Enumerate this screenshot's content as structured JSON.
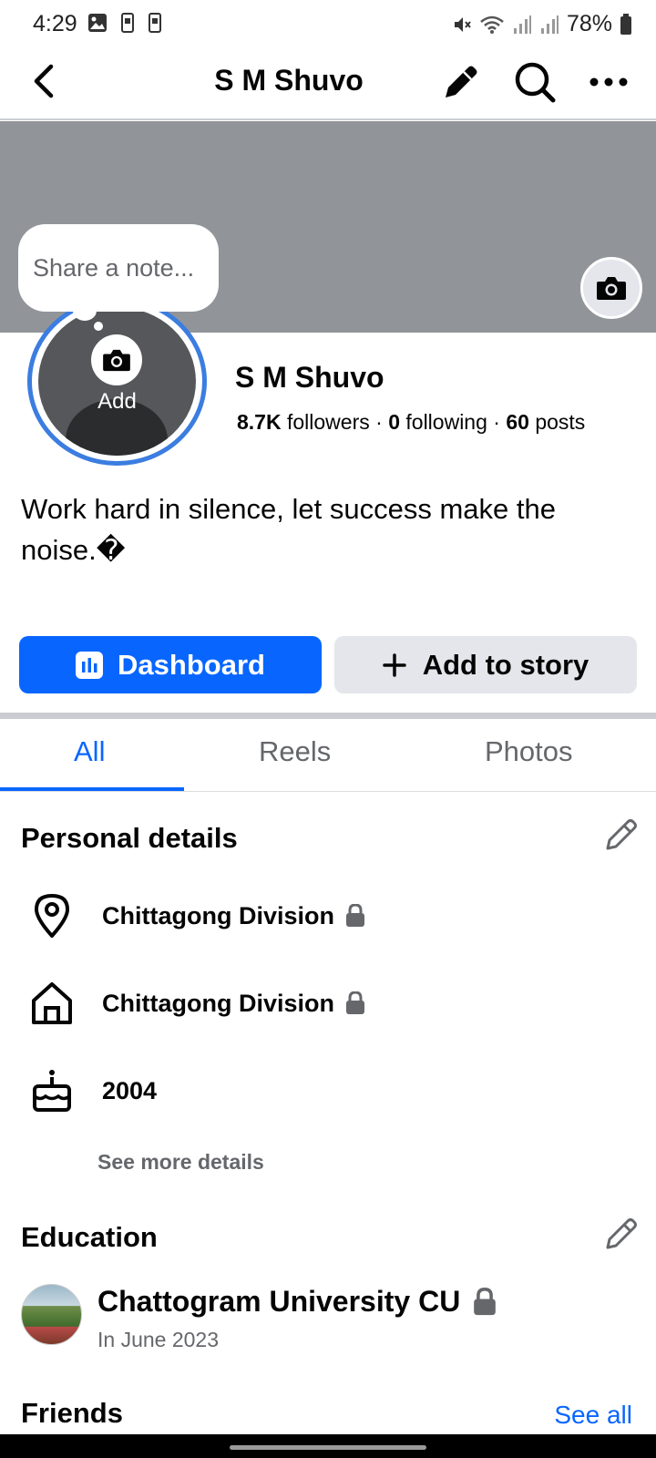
{
  "status_bar": {
    "time": "4:29",
    "battery": "78%"
  },
  "header": {
    "title": "S M Shuvo",
    "icons": [
      "back-arrow-icon",
      "pencil-icon",
      "search-icon",
      "more-icon"
    ]
  },
  "note": {
    "placeholder": "Share a note..."
  },
  "avatar": {
    "add_label": "Add"
  },
  "profile": {
    "name": "S M Shuvo",
    "followers_count": "8.7K",
    "followers_label": "followers",
    "following_count": "0",
    "following_label": "following",
    "posts_count": "60",
    "posts_label": "posts",
    "separator": "·",
    "bio": "Work hard in silence, let success make the noise.�"
  },
  "actions": {
    "dashboard_label": "Dashboard",
    "add_story_label": "Add to story"
  },
  "tabs": [
    {
      "label": "All",
      "active": true
    },
    {
      "label": "Reels",
      "active": false
    },
    {
      "label": "Photos",
      "active": false
    }
  ],
  "personal_details": {
    "title": "Personal details",
    "items": [
      {
        "icon": "location-pin-icon",
        "text": "Chittagong Division",
        "locked": true
      },
      {
        "icon": "home-icon",
        "text": "Chittagong Division",
        "locked": true
      },
      {
        "icon": "birthday-cake-icon",
        "text": "2004",
        "locked": false
      }
    ],
    "see_more": "See more details"
  },
  "education": {
    "title": "Education",
    "school": "Chattogram University CU",
    "date": "In June 2023",
    "locked": true
  },
  "friends": {
    "title": "Friends",
    "see_all": "See all"
  },
  "colors": {
    "accent": "#0866ff",
    "cover": "#919499",
    "avatar_ring": "#3b7de0",
    "secondary_text": "#65676b",
    "button_gray": "#e4e6eb"
  }
}
